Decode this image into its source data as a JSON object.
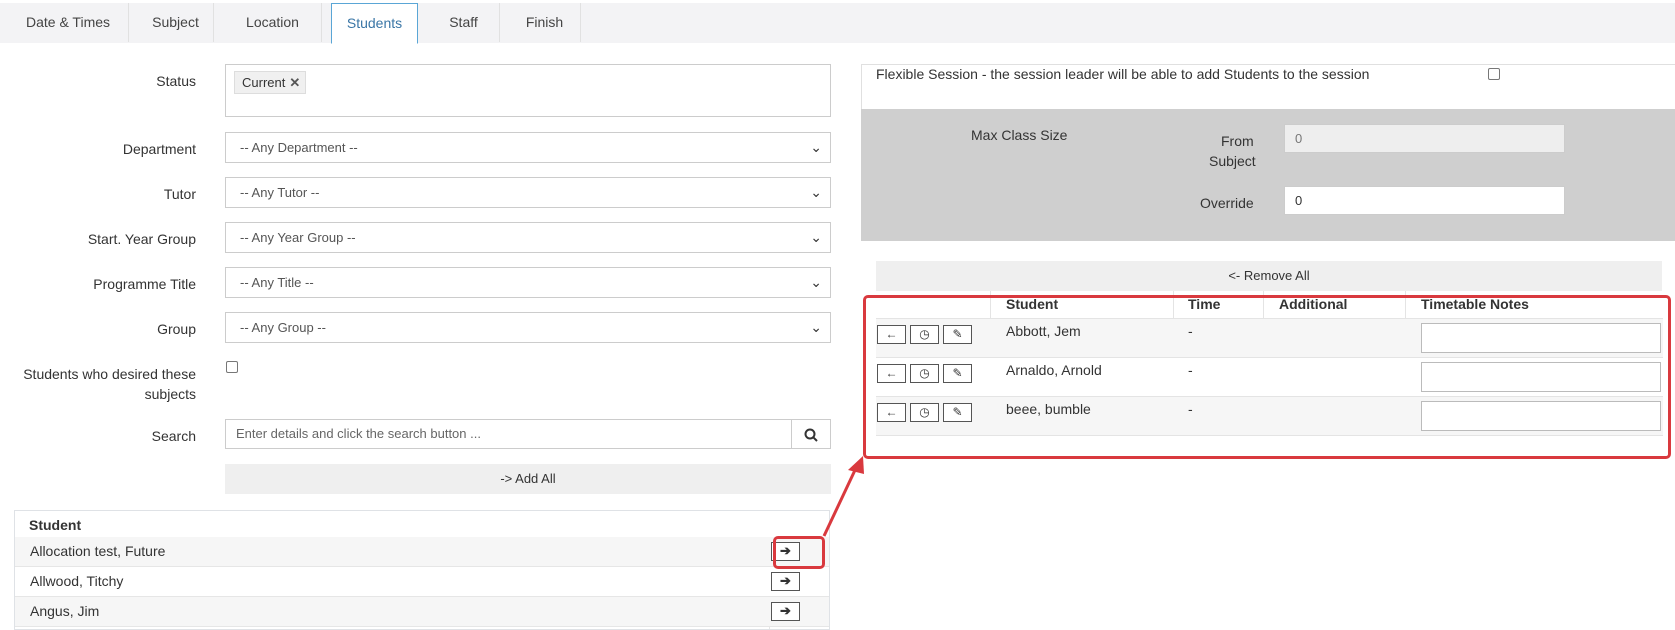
{
  "tabs": [
    {
      "label": "Date & Times"
    },
    {
      "label": "Subject"
    },
    {
      "label": "Location"
    },
    {
      "label": "Students"
    },
    {
      "label": "Staff"
    },
    {
      "label": "Finish"
    }
  ],
  "filters": {
    "status_label": "Status",
    "status_tag": "Current",
    "department_label": "Department",
    "department_value": "-- Any Department --",
    "tutor_label": "Tutor",
    "tutor_value": "-- Any Tutor --",
    "year_label": "Start. Year Group",
    "year_value": "-- Any Year Group --",
    "programme_label": "Programme Title",
    "programme_value": "-- Any Title --",
    "group_label": "Group",
    "group_value": "-- Any Group --",
    "desired_label_1": "Students who desired these",
    "desired_label_2": "subjects",
    "search_label": "Search",
    "search_placeholder": "Enter details and click the search button ...",
    "add_all": "-> Add All"
  },
  "left_table": {
    "header": "Student",
    "rows": [
      {
        "name": "Allocation test, Future"
      },
      {
        "name": "Allwood, Titchy"
      },
      {
        "name": "Angus, Jim"
      }
    ]
  },
  "right": {
    "flexible_text": "Flexible Session - the session leader will be able to add Students to the session",
    "max_class_label": "Max Class Size",
    "from_subject_1": "From",
    "from_subject_2": "Subject",
    "from_subject_value": "0",
    "override_label": "Override",
    "override_value": "0",
    "remove_all": "<- Remove All",
    "headers": {
      "student": "Student",
      "time": "Time",
      "additional": "Additional",
      "notes": "Timetable Notes"
    },
    "rows": [
      {
        "name": "Abbott, Jem",
        "time": "-"
      },
      {
        "name": "Arnaldo, Arnold",
        "time": "-"
      },
      {
        "name": "beee, bumble",
        "time": "-"
      }
    ]
  },
  "colors": {
    "callout": "#d9393e",
    "active_tab_border": "#5aa6d6"
  }
}
